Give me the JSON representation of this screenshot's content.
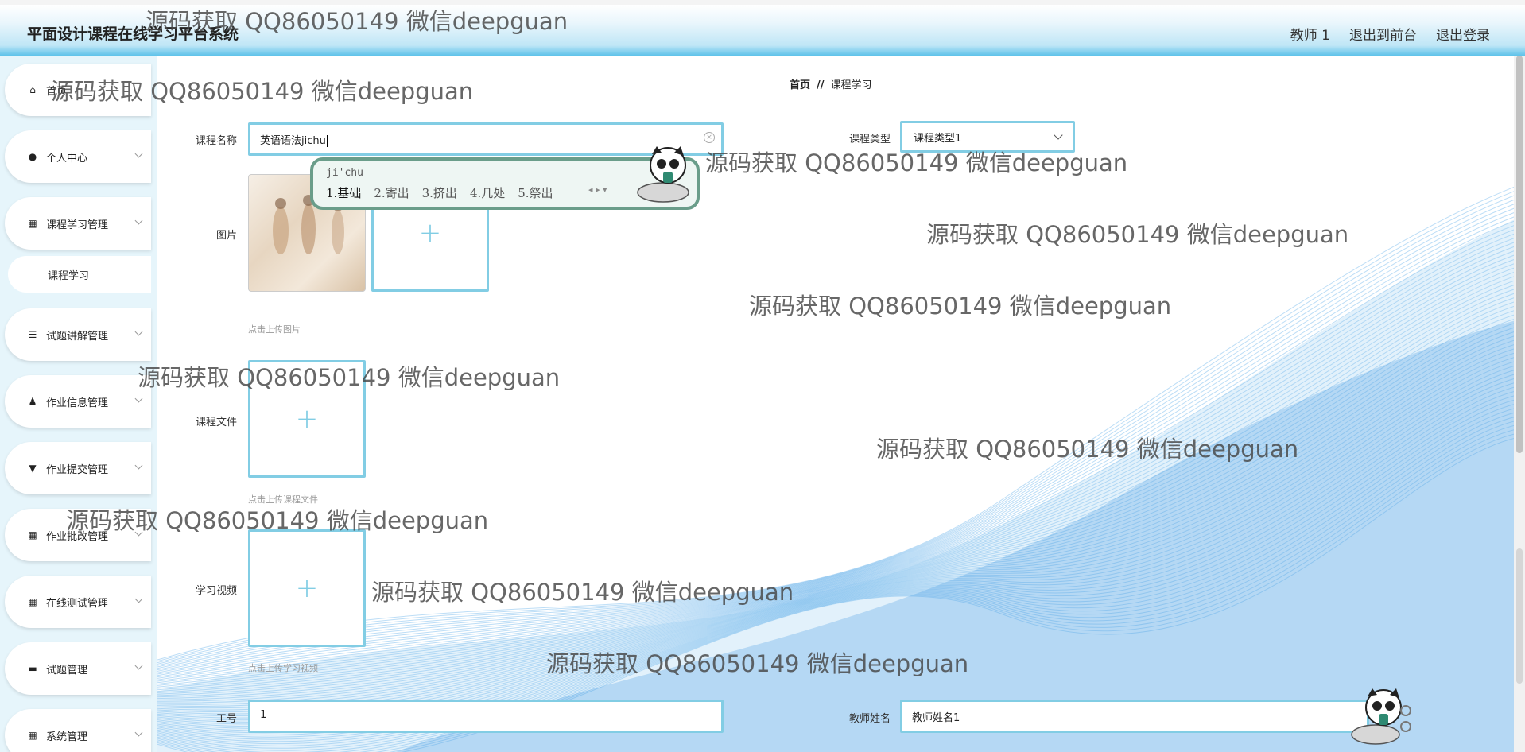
{
  "header": {
    "title": "平面设计课程在线学习平台系统",
    "user": "教师 1",
    "to_front": "退出到前台",
    "logout": "退出登录"
  },
  "sidebar": {
    "items": [
      {
        "label": "首页",
        "icon": "home-icon"
      },
      {
        "label": "个人中心",
        "icon": "user-icon"
      },
      {
        "label": "课程学习管理",
        "icon": "grid-icon"
      },
      {
        "label": "试题讲解管理",
        "icon": "list-icon"
      },
      {
        "label": "作业信息管理",
        "icon": "person-icon"
      },
      {
        "label": "作业提交管理",
        "icon": "pin-icon"
      },
      {
        "label": "作业批改管理",
        "icon": "grid-icon"
      },
      {
        "label": "在线测试管理",
        "icon": "grid-icon"
      },
      {
        "label": "试题管理",
        "icon": "monitor-icon"
      },
      {
        "label": "系统管理",
        "icon": "grid-icon"
      }
    ],
    "sub_item": "课程学习"
  },
  "breadcrumb": {
    "home": "首页",
    "sep": "//",
    "current": "课程学习"
  },
  "form": {
    "course_name_label": "课程名称",
    "course_name_value": "英语语法jichu",
    "course_type_label": "课程类型",
    "course_type_value": "课程类型1",
    "image_label": "图片",
    "image_hint": "点击上传图片",
    "file_label": "课程文件",
    "file_hint": "点击上传课程文件",
    "video_label": "学习视频",
    "video_hint": "点击上传学习视频",
    "job_no_label": "工号",
    "job_no_value": "1",
    "teacher_name_label": "教师姓名",
    "teacher_name_value": "教师姓名1"
  },
  "ime": {
    "pinyin": "ji'chu",
    "candidates": [
      "1.基础",
      "2.寄出",
      "3.挤出",
      "4.几处",
      "5.祭出"
    ],
    "nav": "◂ ▸ ▾"
  },
  "watermark": "源码获取 QQ86050149 微信deepguan",
  "colors": {
    "accent": "#82cde4",
    "header_gradient_end": "#5ec2ea",
    "sidebar_bg": "#e6f5fb",
    "wave": "#4aa8e8"
  }
}
